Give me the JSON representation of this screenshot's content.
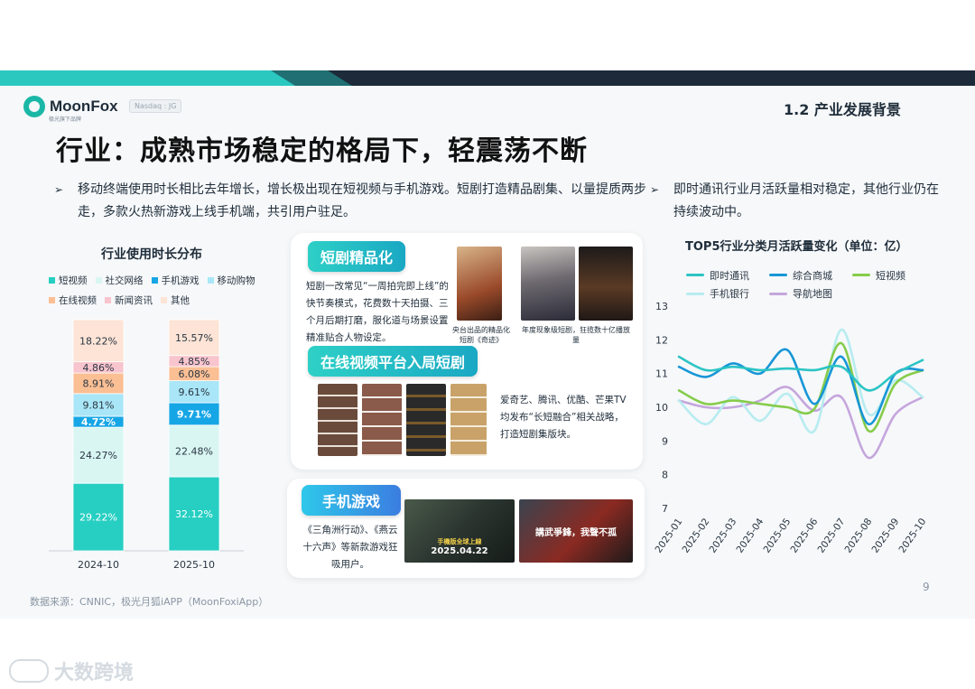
{
  "header": {
    "brand": "MoonFox",
    "brand_sub": "极光旗下品牌",
    "ticker": "Nasdaq : JG",
    "section": "1.2 产业发展背景"
  },
  "title": "行业：成熟市场稳定的格局下，轻震荡不断",
  "bullets": {
    "left": "移动终端使用时长相比去年增长，增长极出现在短视频与手机游戏。短剧打造精品剧集、以量提质两步走，多款火热新游戏上线手机端，共引用户驻足。",
    "right": "即时通讯行业月活跃量相对稳定，其他行业仍在持续波动中。"
  },
  "cards": {
    "short_drama": {
      "label": "短剧精品化",
      "text": "短剧一改常见“一周拍完即上线”的快节奏模式，花费数十天拍摄、三个月后期打磨，服化道与场景设置精准贴合人物设定。",
      "caption1": "央台出品的精品化短剧《奇迹》",
      "caption2": "年度现象级短剧，狂揽数十亿播放量"
    },
    "video_platform": {
      "label": "在线视频平台入局短剧",
      "text": "爱奇艺、腾讯、优酷、芒果TV均发布“长短融合”相关战略，打造短剧集版块。"
    },
    "mobile_game": {
      "label": "手机游戏",
      "text": "《三角洲行动》、《燕云十六声》等新款游戏狂吸用户。",
      "poster1_text": "手機版全球上線",
      "poster1_date": "2025.04.22",
      "poster2_text": "講武爭鋒，我聲不孤"
    }
  },
  "colors": {
    "teal": "#2bc8c0",
    "navy": "#1c2a3a"
  },
  "chart_data": [
    {
      "type": "bar",
      "stacked": true,
      "title": "行业使用时长分布",
      "categories": [
        "2024-10",
        "2025-10"
      ],
      "series": [
        {
          "name": "短视频",
          "color": "#26cfc2",
          "values": [
            29.22,
            32.12
          ],
          "labels": [
            "29.22%",
            "32.12%"
          ]
        },
        {
          "name": "社交网络",
          "color": "#d9f6f3",
          "values": [
            24.27,
            22.48
          ],
          "labels": [
            "24.27%",
            "22.48%"
          ]
        },
        {
          "name": "手机游戏",
          "color": "#16a6e6",
          "values": [
            4.72,
            9.71
          ],
          "labels": [
            "4.72%",
            "9.71%"
          ]
        },
        {
          "name": "移动购物",
          "color": "#a9e6f7",
          "values": [
            9.81,
            9.61
          ],
          "labels": [
            "9.81%",
            "9.61%"
          ]
        },
        {
          "name": "在线视频",
          "color": "#fbbf94",
          "values": [
            8.91,
            6.08
          ],
          "labels": [
            "8.91%",
            "6.08%"
          ]
        },
        {
          "name": "新闻资讯",
          "color": "#f8c4cd",
          "values": [
            4.86,
            4.85
          ],
          "labels": [
            "4.86%",
            "4.85%"
          ]
        },
        {
          "name": "其他",
          "color": "#fde4d6",
          "values": [
            18.22,
            15.57
          ],
          "labels": [
            "18.22%",
            "15.57%"
          ]
        }
      ],
      "legend_position": "top"
    },
    {
      "type": "line",
      "title": "TOP5行业分类月活跃量变化（单位：亿）",
      "x": [
        "2025-01",
        "2025-02",
        "2025-03",
        "2025-04",
        "2025-05",
        "2025-06",
        "2025-07",
        "2025-08",
        "2025-09",
        "2025-10"
      ],
      "ylim": [
        7,
        13
      ],
      "yticks": [
        "7",
        "8",
        "9",
        "10",
        "11",
        "12",
        "13"
      ],
      "grid": false,
      "legend_position": "top",
      "series": [
        {
          "name": "即时通讯",
          "color": "#2cc4c4",
          "values": [
            11.5,
            11.1,
            11.2,
            11.1,
            11.15,
            11.1,
            11.2,
            10.5,
            11.0,
            11.4
          ]
        },
        {
          "name": "综合商城",
          "color": "#1796d6",
          "values": [
            11.2,
            10.9,
            11.3,
            11.0,
            11.7,
            10.1,
            11.5,
            9.5,
            11.0,
            11.1
          ]
        },
        {
          "name": "短视频",
          "color": "#86cc4a",
          "values": [
            10.5,
            10.1,
            10.2,
            10.1,
            10.0,
            9.95,
            11.9,
            9.3,
            10.7,
            11.1
          ]
        },
        {
          "name": "手机银行",
          "color": "#b7ecf0",
          "values": [
            10.2,
            9.5,
            10.3,
            9.6,
            10.4,
            9.3,
            12.3,
            9.8,
            10.8,
            10.3
          ]
        },
        {
          "name": "导航地图",
          "color": "#c5a6dd",
          "values": [
            10.2,
            10.0,
            10.0,
            10.2,
            10.6,
            9.9,
            10.3,
            8.5,
            9.8,
            10.3
          ]
        }
      ]
    }
  ],
  "footer": {
    "page_number": "9",
    "source": "数据来源：CNNIC，极光月狐iAPP（MoonFoxiApp）",
    "watermark": "大数跨境"
  }
}
